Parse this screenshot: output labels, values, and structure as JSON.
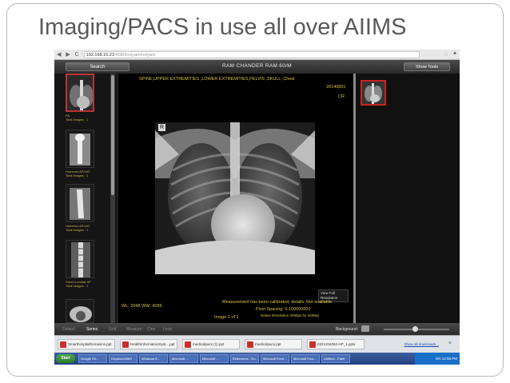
{
  "slide": {
    "title": "Imaging/PACS in use all over AIIMS"
  },
  "browser": {
    "url_host": "192.168.15.23",
    "url_rest": ":8080/oviyam/oviyam",
    "nav_glyphs": "◀ ▶ C",
    "star": "☆",
    "wrench": "✦"
  },
  "app": {
    "search_label": "Search",
    "patient_name": "RAM CHANDER RAM 60/M",
    "show_tools_label": "Show Tools",
    "study_description": "SPINE,UPPER EXTREMITIES ,LOWER EXTREMITIES,PELVIS ,SKULL ,Chest",
    "study_date": "20140801",
    "modality": "CR",
    "marker": "R",
    "wl": "WL: 2048 WW: 4096",
    "view_full": "View Full Resolution",
    "calibration": "Measurement has been calibrated, details: Not available.",
    "pixel_spacing": "Pixel Spacing: 0.100000001",
    "native_resolution": "Native Resolution 3480px by 3480px",
    "image_index": "Image 1 of 1",
    "brand": "Oviyam"
  },
  "thumbnails": [
    {
      "title": "PA",
      "count": "Total Images : 1"
    },
    {
      "title": "Humerus AP/LAT",
      "count": "Total Images : 1"
    },
    {
      "title": "Humerus AP/LAT",
      "count": "Total Images : 1"
    },
    {
      "title": "Dorso-Lumbar AP",
      "count": "Total Images : 1"
    }
  ],
  "bottom_bar": {
    "tools": [
      "Default",
      "Series",
      "Grid",
      "Measure",
      "Cine",
      "Loop"
    ],
    "background_label": "Background:"
  },
  "downloads": {
    "items": [
      "Smarthospitalfromaiims.ppt",
      "HealthInformationSyst....ppt",
      "medicalpacs (1).ppt",
      "medicalpacs.ppt",
      "0221204062-HP_1.pptx"
    ],
    "show_all": "Show all downloads...",
    "close": "×"
  },
  "taskbar": {
    "start_label": "Start",
    "tasks": [
      "Google Ch...",
      "DropboxAIIMS",
      "Windows E...",
      "Microsoft ...",
      "Microsoft ...",
      "Extensions - Go...",
      "Microsoft Exce...",
      "Microsoft Pow...",
      "Untitled - Paint"
    ],
    "clock": "EN  12:58 PM"
  }
}
